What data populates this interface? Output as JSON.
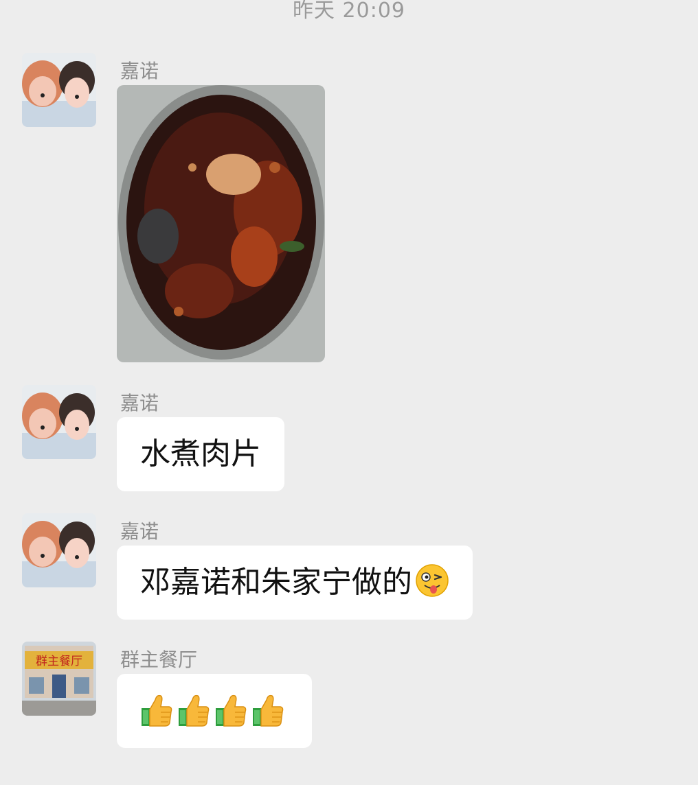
{
  "header": {
    "timestamp": "昨天 20:09"
  },
  "messages": [
    {
      "sender": "嘉诺",
      "type": "image",
      "image_desc": "pot of spicy boiled meat slices"
    },
    {
      "sender": "嘉诺",
      "type": "text",
      "text": "水煮肉片"
    },
    {
      "sender": "嘉诺",
      "type": "text",
      "text": "邓嘉诺和朱家宁做的",
      "trailing_emoji": "wink-tongue-emoji"
    },
    {
      "sender": "群主餐厅",
      "type": "emoji",
      "emojis": [
        "thumbs-up-emoji",
        "thumbs-up-emoji",
        "thumbs-up-emoji",
        "thumbs-up-emoji"
      ]
    }
  ],
  "avatars": {
    "jianuo": "two-girls-cat-filter-avatar",
    "restaurant": "restaurant-building-avatar",
    "restaurant_sign": "群主餐厅"
  },
  "colors": {
    "background": "#ededed",
    "bubble": "#ffffff",
    "meta_text": "#8e8e8e"
  }
}
